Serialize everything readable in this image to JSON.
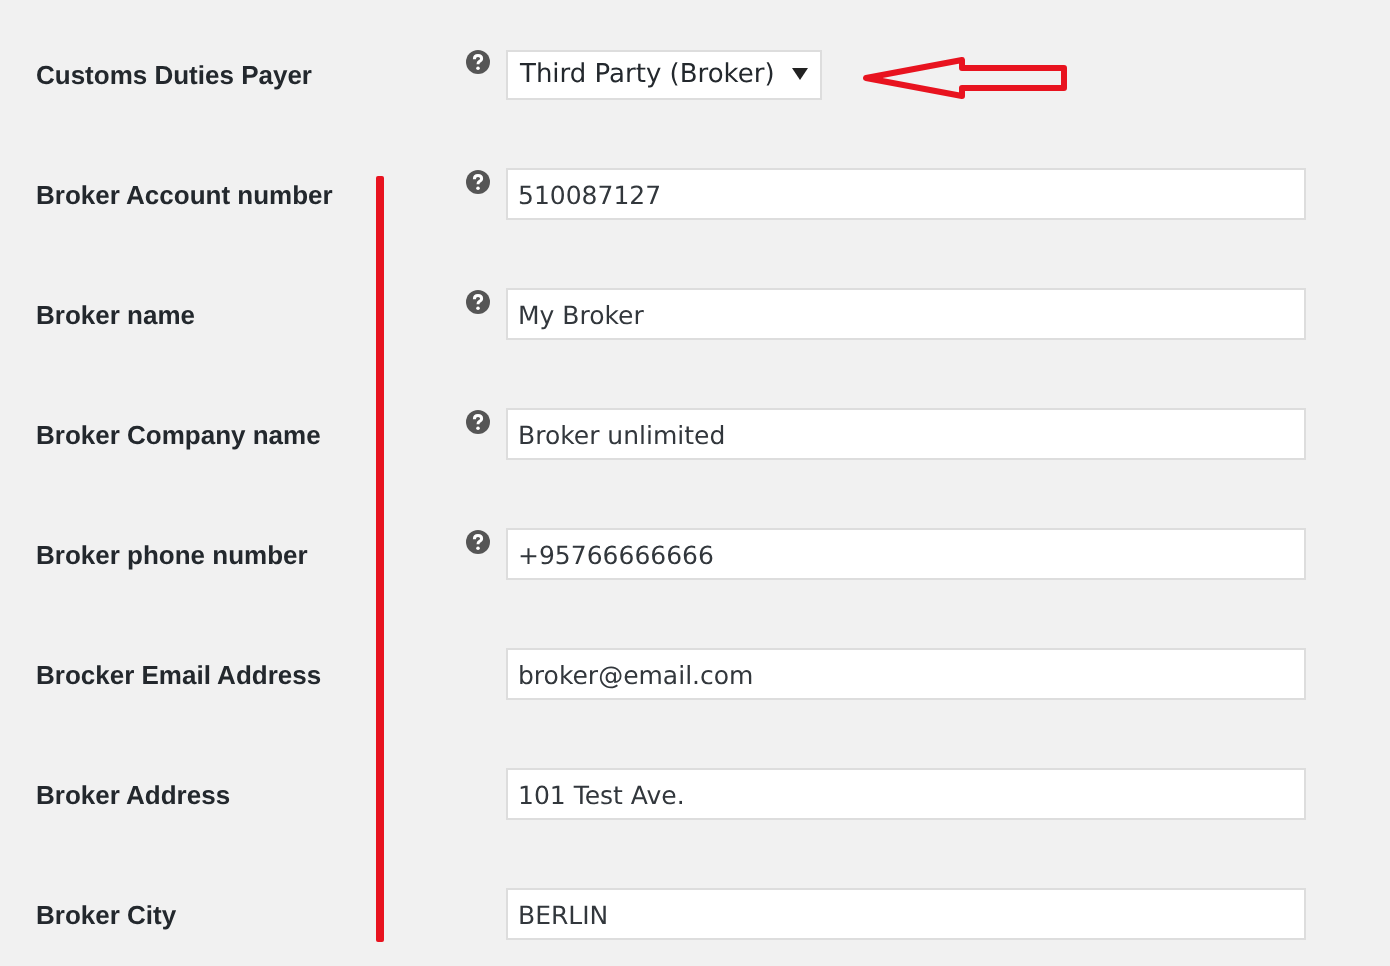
{
  "fields": [
    {
      "label": "Customs Duties Payer",
      "help": true,
      "kind": "select",
      "value": "Third Party (Broker)"
    },
    {
      "label": "Broker Account number",
      "help": true,
      "kind": "text",
      "value": "510087127"
    },
    {
      "label": "Broker name",
      "help": true,
      "kind": "text",
      "value": "My Broker"
    },
    {
      "label": "Broker Company name",
      "help": true,
      "kind": "text",
      "value": "Broker unlimited"
    },
    {
      "label": "Broker phone number",
      "help": true,
      "kind": "text",
      "value": "+95766666666"
    },
    {
      "label": "Brocker Email Address",
      "help": false,
      "kind": "text",
      "value": "broker@email.com"
    },
    {
      "label": "Broker Address",
      "help": false,
      "kind": "text",
      "value": "101 Test Ave."
    },
    {
      "label": "Broker City",
      "help": false,
      "kind": "text",
      "value": "BERLIN"
    }
  ]
}
